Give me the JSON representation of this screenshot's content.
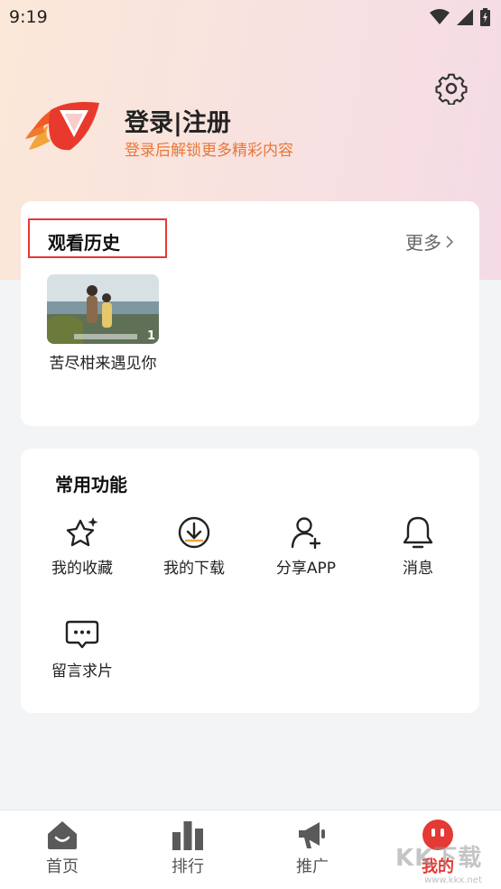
{
  "status_bar": {
    "time": "9:19"
  },
  "profile": {
    "login_title": "登录|注册",
    "login_subtitle": "登录后解锁更多精彩内容"
  },
  "history": {
    "title": "观看历史",
    "more_label": "更多",
    "items": [
      {
        "title": "苦尽柑来遇见你",
        "episode": "1"
      }
    ]
  },
  "functions": {
    "title": "常用功能",
    "items": [
      {
        "label": "我的收藏",
        "icon": "star-icon"
      },
      {
        "label": "我的下载",
        "icon": "download-icon"
      },
      {
        "label": "分享APP",
        "icon": "share-user-icon"
      },
      {
        "label": "消息",
        "icon": "bell-icon"
      },
      {
        "label": "留言求片",
        "icon": "chat-icon"
      }
    ]
  },
  "tabbar": {
    "items": [
      {
        "label": "首页",
        "icon": "home-icon"
      },
      {
        "label": "排行",
        "icon": "ranking-icon"
      },
      {
        "label": "推广",
        "icon": "megaphone-icon"
      },
      {
        "label": "我的",
        "icon": "profile-face-icon",
        "active": true
      }
    ]
  },
  "watermark": {
    "text": "KK下载",
    "url": "www.kkx.net"
  },
  "colors": {
    "accent": "#e53935",
    "subtitle": "#e8763a",
    "highlight_border": "#e53935"
  }
}
